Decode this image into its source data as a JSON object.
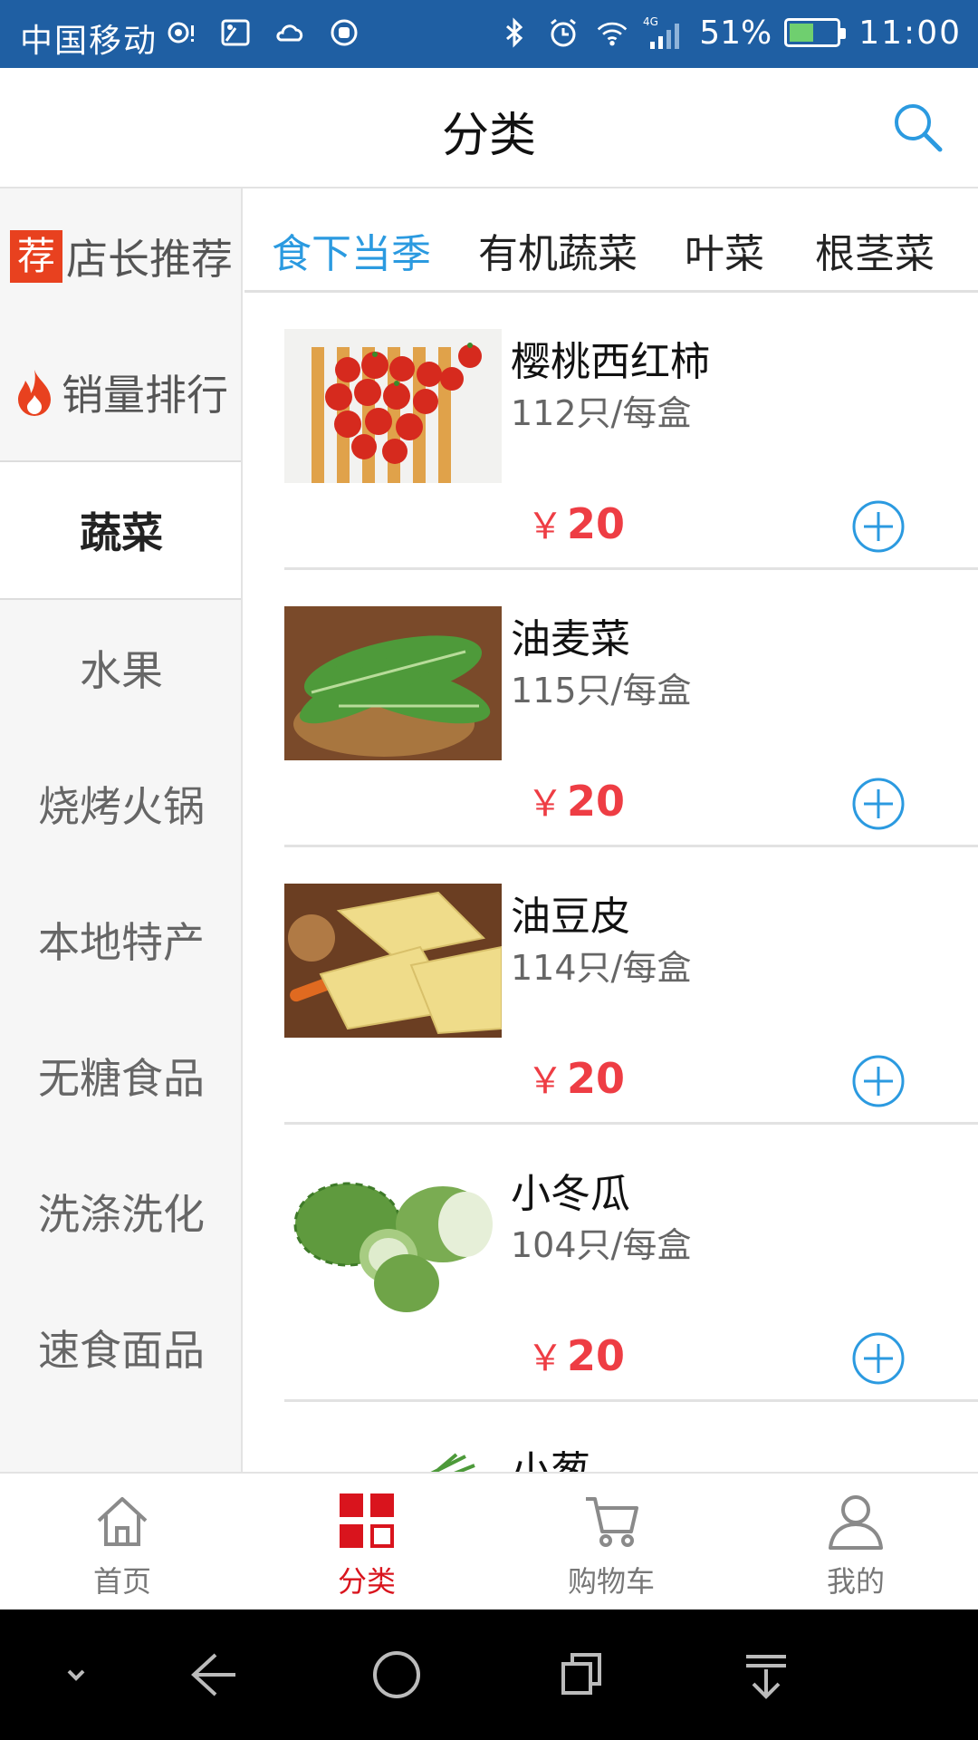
{
  "status_bar": {
    "carrier": "中国移动",
    "network": "4G",
    "battery": "51%",
    "time": "11:00",
    "battery_level": 0.51
  },
  "header": {
    "title": "分类"
  },
  "sidebar": {
    "items": [
      {
        "label": "店长推荐",
        "badge": "荐"
      },
      {
        "label": "销量排行"
      },
      {
        "label": "蔬菜",
        "active": true
      },
      {
        "label": "水果"
      },
      {
        "label": "烧烤火锅"
      },
      {
        "label": "本地特产"
      },
      {
        "label": "无糖食品"
      },
      {
        "label": "洗涤洗化"
      },
      {
        "label": "速食面品"
      }
    ]
  },
  "tabs": [
    {
      "label": "食下当季",
      "active": true
    },
    {
      "label": "有机蔬菜"
    },
    {
      "label": "叶菜"
    },
    {
      "label": "根茎菜"
    }
  ],
  "products": [
    {
      "name": "樱桃西红柿",
      "spec": "112只/每盒",
      "currency": "￥",
      "price": "20"
    },
    {
      "name": "油麦菜",
      "spec": "115只/每盒",
      "currency": "￥",
      "price": "20"
    },
    {
      "name": "油豆皮",
      "spec": "114只/每盒",
      "currency": "￥",
      "price": "20"
    },
    {
      "name": "小冬瓜",
      "spec": "104只/每盒",
      "currency": "￥",
      "price": "20"
    },
    {
      "name": "小葱"
    }
  ],
  "bottom_nav": [
    {
      "label": "首页",
      "icon": "home-icon"
    },
    {
      "label": "分类",
      "icon": "category-icon",
      "active": true
    },
    {
      "label": "购物车",
      "icon": "cart-icon"
    },
    {
      "label": "我的",
      "icon": "user-icon"
    }
  ],
  "colors": {
    "status_bar": "#1f5fa3",
    "accent_blue": "#2b9ae0",
    "price_red": "#ee3d44",
    "nav_active_red": "#d9141d"
  }
}
